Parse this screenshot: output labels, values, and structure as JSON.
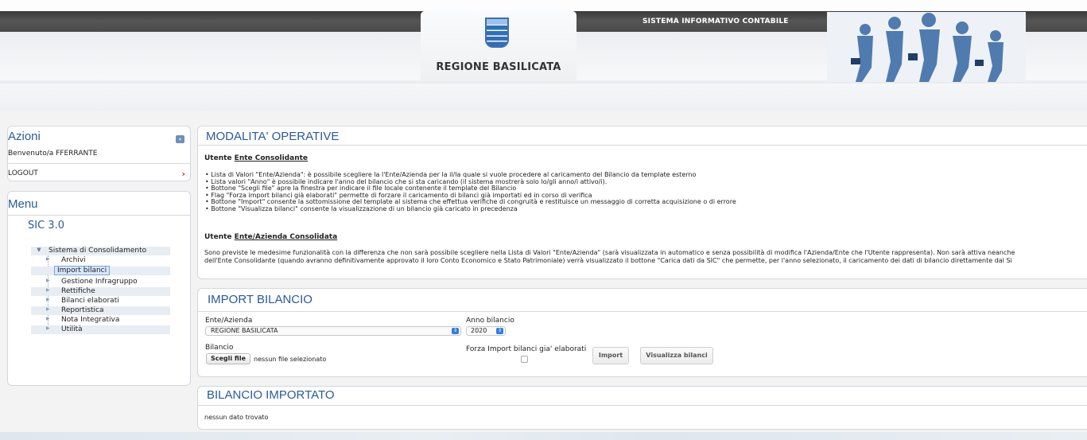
{
  "header": {
    "system_title": "SISTEMA INFORMATIVO CONTABILE",
    "region_name": "REGIONE BASILICATA"
  },
  "azioni": {
    "title": "Azioni",
    "welcome": "Benvenuto/a FFERRANTE",
    "logout": "LOGOUT"
  },
  "menu": {
    "title": "Menu",
    "app": "SIC 3.0",
    "root": "Sistema di Consolidamento",
    "items": [
      {
        "label": "Archivi"
      },
      {
        "label": "Import bilanci"
      },
      {
        "label": "Gestione Infragruppo"
      },
      {
        "label": "Rettifiche"
      },
      {
        "label": "Bilanci elaborati"
      },
      {
        "label": "Reportistica"
      },
      {
        "label": "Nota Integrativa"
      },
      {
        "label": "Utilità"
      }
    ]
  },
  "modalita": {
    "title": "MODALITA' OPERATIVE",
    "section1_prefix": "Utente ",
    "section1_link": "Ente Consolidante",
    "bullets": [
      "Lista di Valori \"Ente/Azienda\": è possibile scegliere la l'Ente/Azienda per la il/la quale si vuole procedere al caricamento del Bilancio da template esterno",
      "Lista valori \"Anno\" è possibile indicare l'anno del bilancio che si sta caricando (il sistema mostrerà solo lo/gli anno/i attivo/i).",
      "Bottone \"Scegli file\" apre la finestra per indicare il file locale contenente il template del Bilancio",
      "Flag \"Forza import bilanci già elaborati\" permette di forzare il caricamento di bilanci già importati ed in corso di verifica",
      "Bottone \"Import\" consente la sottomissione del template al sistema che effettua verifiche di congruità e restituisce un messaggio di corretta acquisizione o di errore",
      "Bottone \"Visualizza bilanci\" consente la visualizzazione di un bilancio già caricato in precedenza"
    ],
    "section2_prefix": "Utente ",
    "section2_link": "Ente/Azienda Consolidata",
    "para_line1": "Sono previste le medesime funzionalità con la differenza che non sarà possibile scegliere nella Lista di Valori \"Ente/Azienda\" (sarà visualizzata in automatico e senza possibilità di modifica l'Azienda/Ente che l'Utente rappresenta). Non sarà attiva neanche",
    "para_line2": "dell'Ente Consolidante (quando avranno definitivamente approvato il loro Conto Economico e Stato Patrimoniale) verrà visualizzato il bottone \"Carica dati da SIC\" che permette, per l'anno selezionato, il caricamento dei dati di bilancio direttamente dal Si"
  },
  "import": {
    "title": "IMPORT BILANCIO",
    "ente_label": "Ente/Azienda",
    "ente_value": "REGIONE BASILICATA",
    "anno_label": "Anno bilancio",
    "anno_value": "2020",
    "bilancio_label": "Bilancio",
    "file_button": "Scegli file",
    "file_status": "nessun file selezionato",
    "forza_label": "Forza Import bilanci gia' elaborati",
    "forza_checked": false,
    "import_button": "Import",
    "visualizza_button": "Visualizza bilanci"
  },
  "importato": {
    "title": "BILANCIO IMPORTATO",
    "empty_text": "nessun dato trovato"
  }
}
